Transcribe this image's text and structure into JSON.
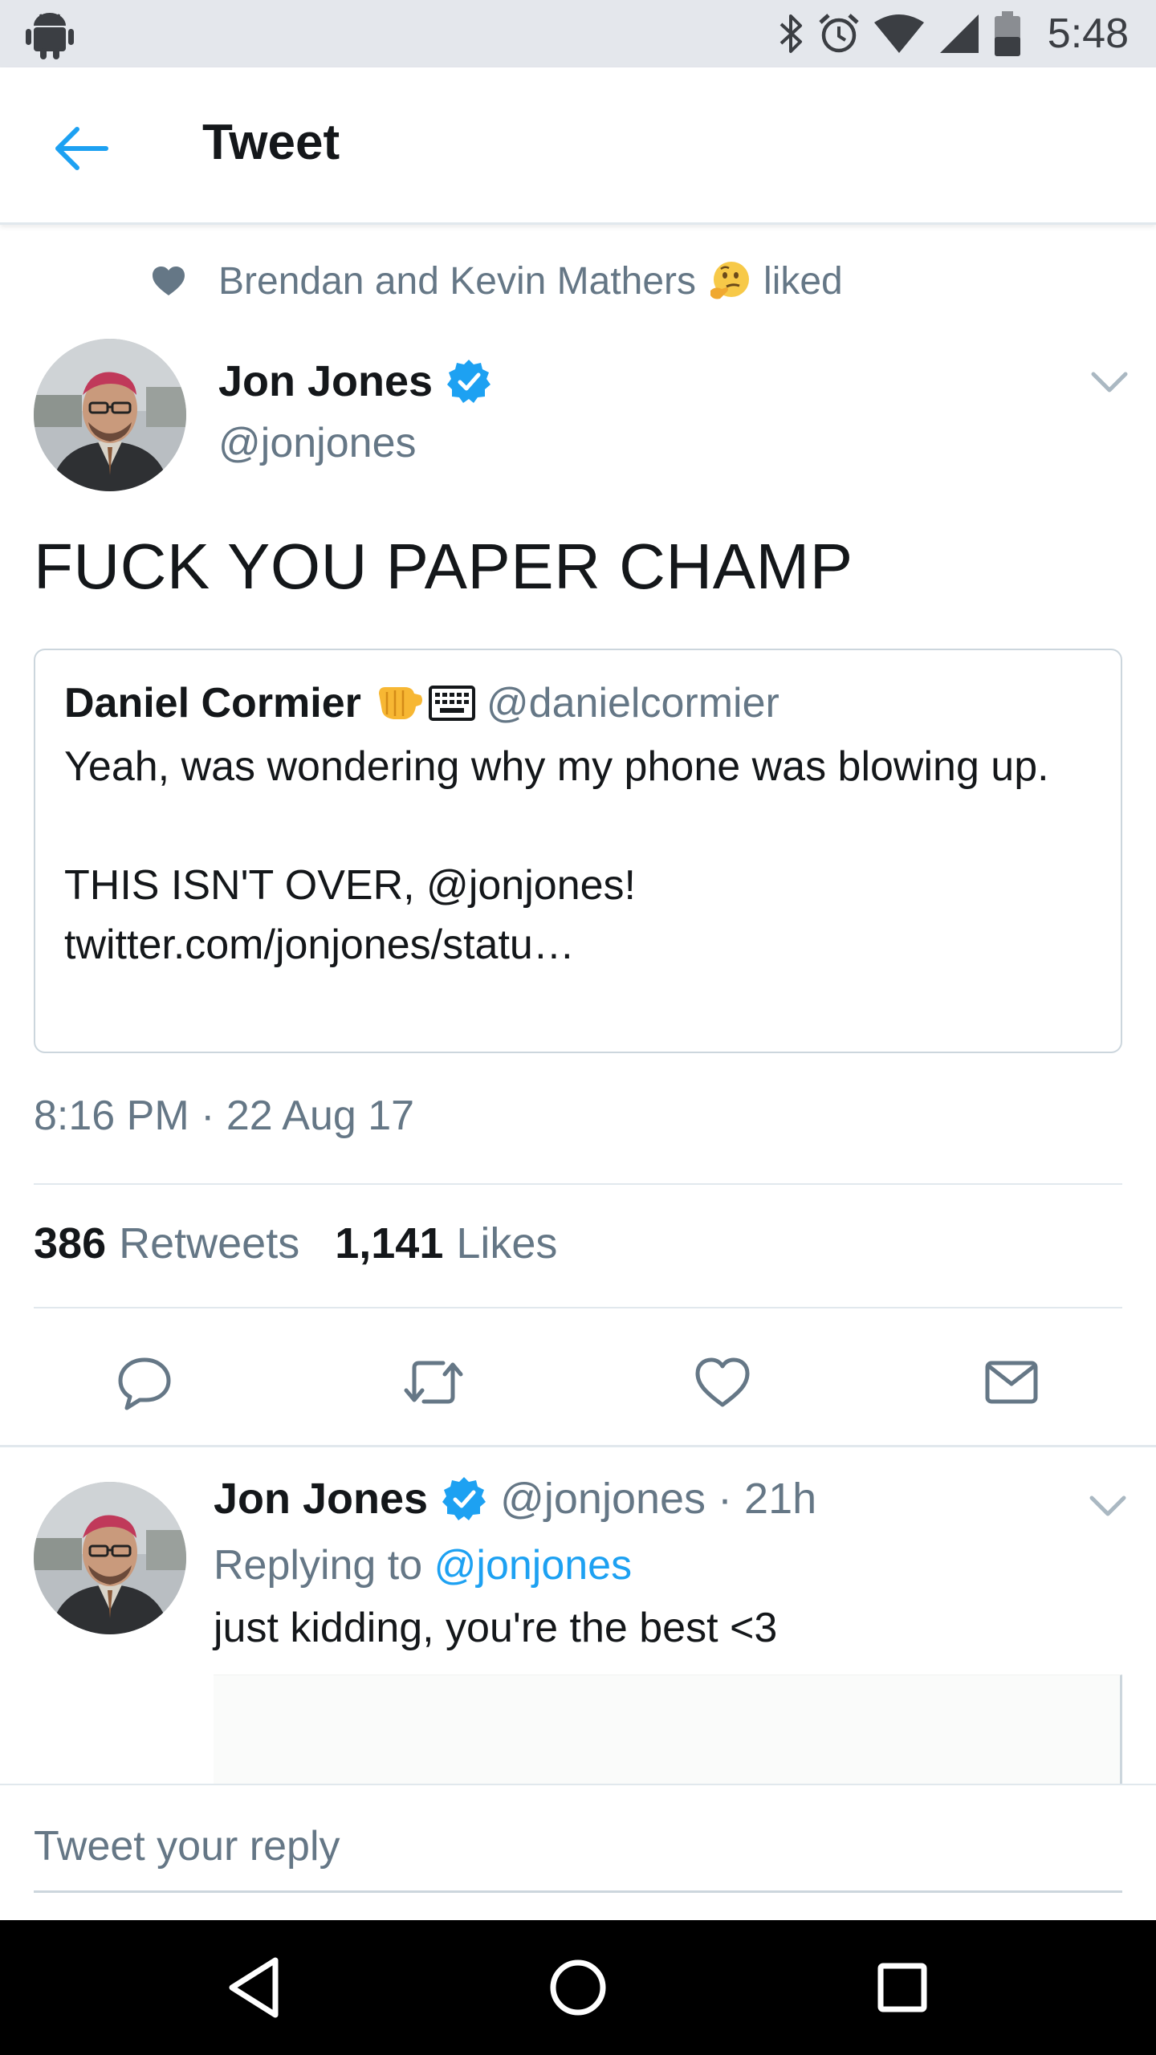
{
  "status_bar": {
    "time": "5:48",
    "icons": [
      "android-icon",
      "bluetooth-icon",
      "alarm-icon",
      "wifi-icon",
      "signal-icon",
      "battery-icon"
    ]
  },
  "header": {
    "back_icon": "arrow-left-icon",
    "title": "Tweet"
  },
  "social_context": {
    "icon": "heart-icon",
    "text_before": "Brendan and Kevin Mathers",
    "emoji": "thinking-face-emoji",
    "text_after": "liked"
  },
  "tweet": {
    "author_name": "Jon Jones",
    "author_handle": "@jonjones",
    "verified": true,
    "text": "FUCK YOU PAPER CHAMP",
    "quote": {
      "author_name": "Daniel Cormier",
      "author_emojis": [
        "left-facing-fist-emoji",
        "keyboard-emoji"
      ],
      "author_handle": "@danielcormier",
      "text_line_1": "Yeah, was wondering why my phone was blowing up.",
      "text_line_2": "THIS ISN'T OVER, @jonjones! twitter.com/jonjones/statu…"
    },
    "timestamp": "8:16 PM · 22 Aug 17",
    "retweets_count": "386",
    "retweets_label": "Retweets",
    "likes_count": "1,141",
    "likes_label": "Likes",
    "actions": [
      "reply-icon",
      "retweet-icon",
      "like-icon",
      "direct-message-icon"
    ]
  },
  "reply": {
    "author_name": "Jon Jones",
    "verified": true,
    "meta": "@jonjones · 21h",
    "replying_prefix": "Replying to",
    "replying_mention": "@jonjones",
    "text": "just kidding, you're the best <3"
  },
  "composer": {
    "placeholder": "Tweet your reply"
  },
  "colors": {
    "accent": "#1da1f2",
    "secondary_text": "#657786",
    "primary_text": "#14171a",
    "divider": "#e1e8ed",
    "status_bar": "#e4e7ec"
  }
}
